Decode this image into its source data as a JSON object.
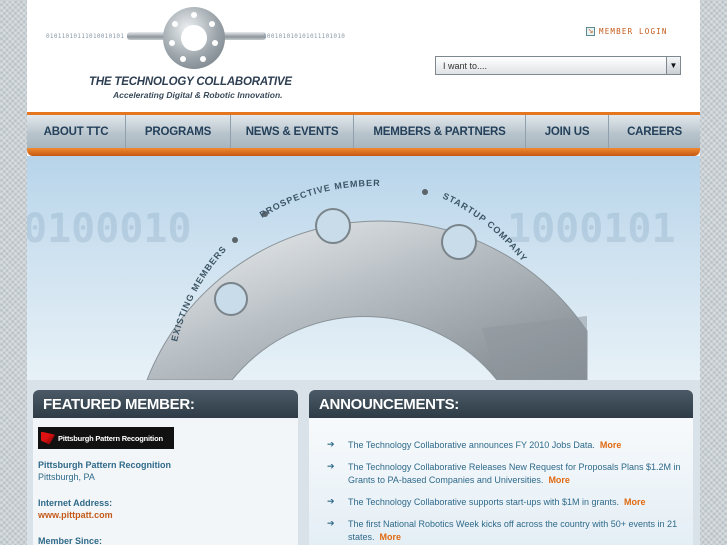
{
  "header": {
    "binary_left": "01011010111010010101",
    "binary_right": "100101010101011101010",
    "logo_title": "THE TECHNOLOGY COLLABORATIVE",
    "logo_tagline": "Accelerating Digital & Robotic Innovation.",
    "member_login": "MEMBER LOGIN",
    "dropdown_value": "I want to...."
  },
  "nav": {
    "items": [
      {
        "label": "ABOUT TTC"
      },
      {
        "label": "PROGRAMS"
      },
      {
        "label": "NEWS & EVENTS"
      },
      {
        "label": "MEMBERS & PARTNERS"
      },
      {
        "label": "JOIN US"
      },
      {
        "label": "CAREERS"
      }
    ]
  },
  "hero": {
    "binary_left": "0100010",
    "binary_right": "1000101",
    "gear_labels": [
      "EXISTING MEMBERS",
      "PROSPECTIVE MEMBERS",
      "STARTUP COMPANY"
    ]
  },
  "featured": {
    "heading": "FEATURED MEMBER:",
    "logo_text": "Pittsburgh Pattern Recognition",
    "name": "Pittsburgh Pattern Recognition",
    "location": "Pittsburgh, PA",
    "internet_label": "Internet Address:",
    "url": "www.pittpatt.com",
    "since_label": "Member Since:"
  },
  "announcements": {
    "heading": "ANNOUNCEMENTS:",
    "more_label": "More",
    "items": [
      {
        "text": "The Technology Collaborative announces FY 2010 Jobs Data."
      },
      {
        "text": "The Technology Collaborative Releases New Request for Proposals Plans $1.2M in Grants to PA-based Companies and Universities."
      },
      {
        "text": "The Technology Collaborative supports start-ups with $1M in grants."
      },
      {
        "text": "The first National Robotics Week kicks off across the country with 50+ events in 21 states."
      }
    ]
  },
  "colors": {
    "accent_orange": "#e3761f",
    "nav_text": "#24405a",
    "link_blue": "#2f6a8a"
  },
  "icons": {
    "login": "arrow-box-icon",
    "dropdown": "caret-down-icon",
    "bullet": "arrow-right-icon"
  }
}
